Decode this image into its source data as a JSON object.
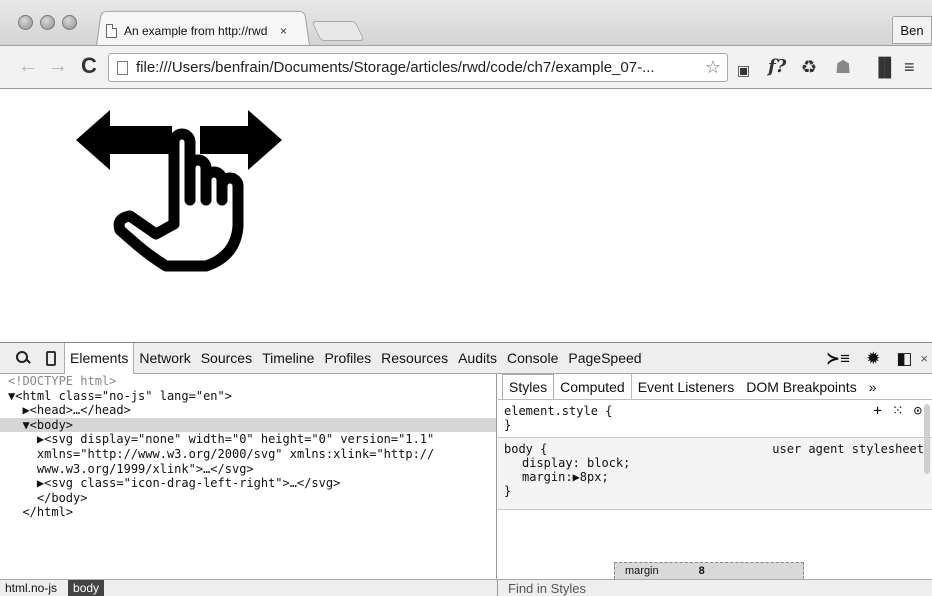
{
  "browser": {
    "tab_title": "An example from http://rwd",
    "tab_close": "×",
    "profile_name": "Ben",
    "url": "file:///Users/benfrain/Documents/Storage/articles/rwd/code/ch7/example_07-...",
    "back_glyph": "←",
    "forward_glyph": "→",
    "reload_glyph": "C",
    "bookmark_glyph": "☆",
    "extensions": [
      {
        "name": "cast-icon",
        "glyph": "▣"
      },
      {
        "name": "fonts-extension-icon",
        "glyph": "f?"
      },
      {
        "name": "recycle-icon",
        "glyph": "♻"
      },
      {
        "name": "android-icon",
        "glyph": "☗"
      },
      {
        "name": "panel-icon",
        "glyph": "▐▌"
      },
      {
        "name": "menu-icon",
        "glyph": "≡"
      }
    ]
  },
  "page": {
    "graphic": "icon-drag-left-right"
  },
  "devtools": {
    "tabs": [
      "Elements",
      "Network",
      "Sources",
      "Timeline",
      "Profiles",
      "Resources",
      "Audits",
      "Console",
      "PageSpeed"
    ],
    "active_tab": "Elements",
    "right_icons": [
      "≻≡",
      "✹",
      "◧"
    ],
    "close": "×",
    "dom_lines": [
      "<!DOCTYPE html>",
      "▼<html class=\"no-js\" lang=\"en\">",
      "  ▶<head>…</head>",
      "  ▼<body>",
      "    ▶<svg display=\"none\" width=\"0\" height=\"0\" version=\"1.1\"",
      "    xmlns=\"http://www.w3.org/2000/svg\" xmlns:xlink=\"http://",
      "    www.w3.org/1999/xlink\">…</svg>",
      "    ▶<svg class=\"icon-drag-left-right\">…</svg>",
      "    </body>",
      "  </html>"
    ],
    "selected_line": 3,
    "style_tabs": [
      "Styles",
      "Computed",
      "Event Listeners",
      "DOM Breakpoints"
    ],
    "style_more": "»",
    "element_style_selector": "element.style {",
    "element_style_close": "}",
    "element_style_icons": [
      "+",
      "⁙",
      "⊙"
    ],
    "body_rule": {
      "selector": "body {",
      "origin": "user agent stylesheet",
      "props": [
        "display: block;",
        "margin:▶8px;"
      ],
      "close": "}"
    },
    "box_model": {
      "label": "margin",
      "value": "8"
    },
    "breadcrumbs": [
      "html.no-js",
      "body"
    ],
    "find_placeholder": "Find in Styles"
  }
}
